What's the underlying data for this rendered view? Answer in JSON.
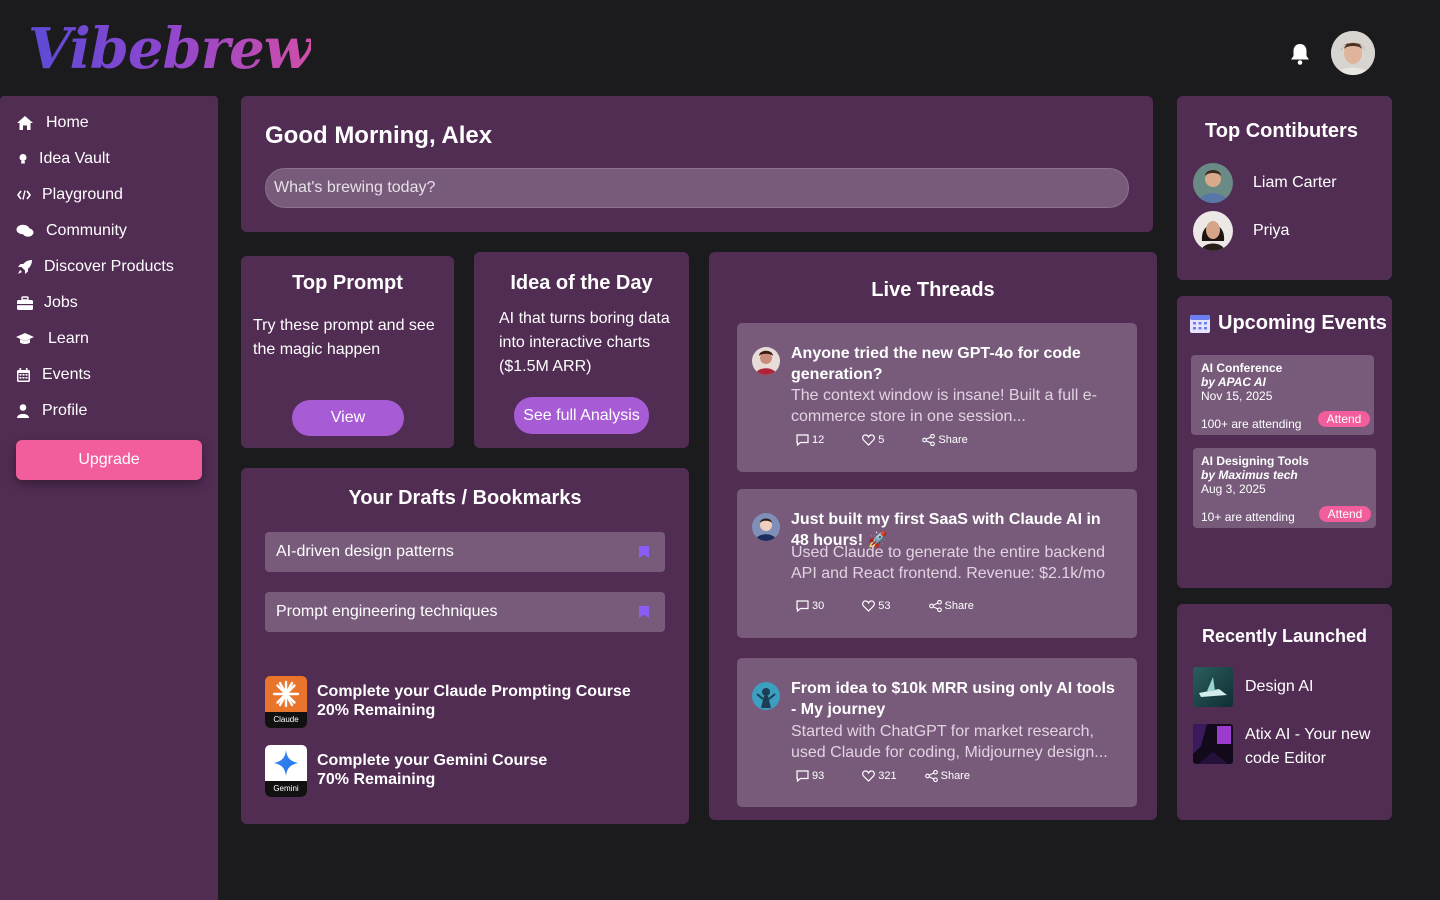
{
  "app": {
    "logo": "Vibebrew"
  },
  "header": {
    "bell_icon": "bell-icon",
    "avatar_icon": "user-avatar"
  },
  "sidebar": {
    "items": [
      {
        "label": "Home",
        "icon": "home-icon"
      },
      {
        "label": "Idea Vault",
        "icon": "lightbulb-icon"
      },
      {
        "label": "Playground",
        "icon": "code-icon"
      },
      {
        "label": "Community",
        "icon": "chat-icon"
      },
      {
        "label": "Discover Products",
        "icon": "rocket-icon"
      },
      {
        "label": "Jobs",
        "icon": "briefcase-icon"
      },
      {
        "label": "Learn",
        "icon": "graduation-cap-icon"
      },
      {
        "label": "Events",
        "icon": "calendar-icon"
      },
      {
        "label": "Profile",
        "icon": "user-icon"
      }
    ],
    "upgrade_label": "Upgrade"
  },
  "greeting": {
    "title": "Good Morning, Alex",
    "placeholder": "What's brewing today?"
  },
  "top_prompt": {
    "title": "Top Prompt",
    "text": "Try these prompt and see the magic happen",
    "button": "View"
  },
  "idea_of_day": {
    "title": "Idea of the Day",
    "text": "AI that turns boring data into interactive charts ($1.5M ARR)",
    "button": "See full Analysis"
  },
  "drafts": {
    "title": "Your Drafts / Bookmarks",
    "bookmarks": [
      {
        "label": "AI-driven design patterns"
      },
      {
        "label": "Prompt engineering techniques"
      }
    ],
    "courses": [
      {
        "logo_tag": "Claude",
        "title": "Complete your Claude Prompting Course",
        "remaining": "20% Remaining",
        "color": "#e9742b"
      },
      {
        "logo_tag": "Gemini",
        "title": "Complete your Gemini Course",
        "remaining": "70% Remaining",
        "color": "#ffffff"
      }
    ]
  },
  "live_threads": {
    "title": "Live Threads",
    "threads": [
      {
        "title": "Anyone tried the new GPT-4o for code generation?",
        "body": "The context window is insane! Built a full e-commerce store in one session...",
        "comments": "12",
        "likes": "5",
        "share": "Share"
      },
      {
        "title": "Just built my first SaaS with Claude AI in 48 hours! 🚀",
        "body": "Used Claude to generate the entire backend API and React frontend. Revenue: $2.1k/mo",
        "comments": "30",
        "likes": "53",
        "share": "Share"
      },
      {
        "title": "From idea to $10k MRR using only AI tools - My journey",
        "body": "Started with ChatGPT for market research, used Claude for coding, Midjourney design...",
        "comments": "93",
        "likes": "321",
        "share": "Share"
      }
    ]
  },
  "contributors": {
    "title": "Top Contibuters",
    "people": [
      {
        "name": "Liam Carter"
      },
      {
        "name": "Priya"
      }
    ]
  },
  "events": {
    "title": "Upcoming Events",
    "items": [
      {
        "title": "AI Conference",
        "by": "by APAC AI",
        "date": "Nov 15, 2025",
        "attending": "100+ are attending",
        "button": "Attend"
      },
      {
        "title": "AI Designing Tools",
        "by": "by Maximus tech",
        "date": "Aug 3, 2025",
        "attending": "10+ are attending",
        "button": "Attend"
      }
    ]
  },
  "launched": {
    "title": "Recently Launched",
    "items": [
      {
        "label": "Design AI"
      },
      {
        "label": "Atix AI - Your new code Editor"
      }
    ]
  },
  "colors": {
    "background": "#1b1b1d",
    "card": "#512c53",
    "inner": "#785b7b",
    "accent_pink": "#f25d9c",
    "accent_purple": "#a75bd4"
  }
}
